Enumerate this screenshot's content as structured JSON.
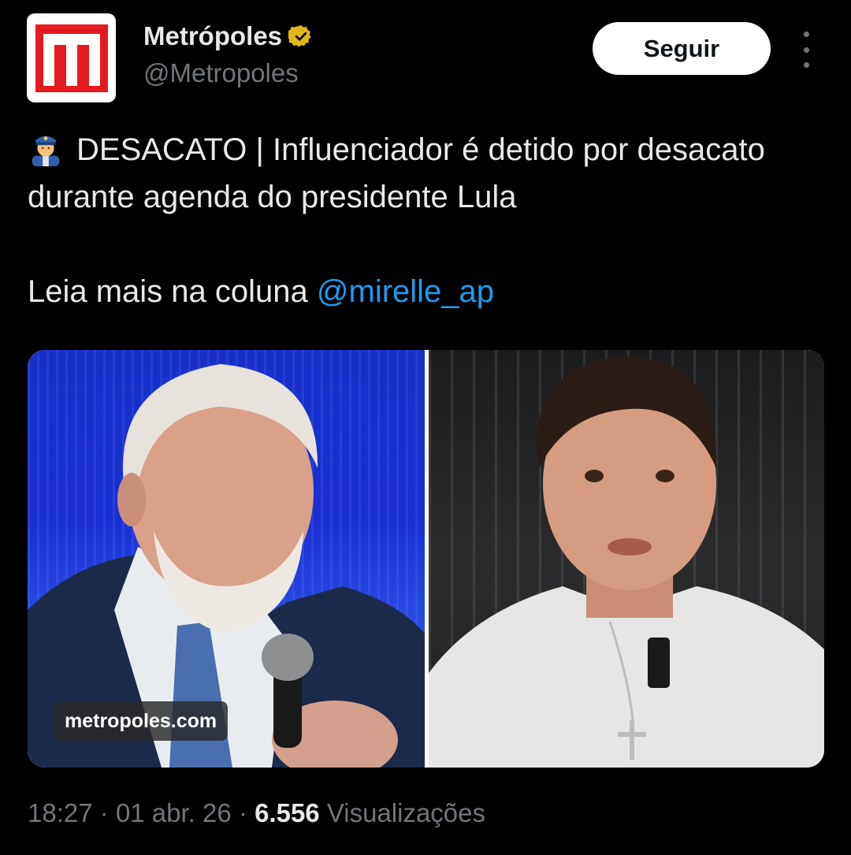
{
  "author": {
    "name": "Metrópoles",
    "handle": "@Metropoles",
    "verified": true,
    "avatar_icon": "metropoles-logo",
    "brand_color": "#e51a1f"
  },
  "follow_button": {
    "label": "Seguir"
  },
  "more_button": {
    "icon": "more-vertical-icon"
  },
  "tweet": {
    "emoji": "police-officer-icon",
    "line1": "DESACATO | Influenciador é detido por desacato durante agenda do presidente Lula",
    "line2_prefix": "Leia mais na coluna ",
    "mention": "@mirelle_ap",
    "mention_color": "#1d9bf0"
  },
  "media": {
    "watermark": "metropoles.com"
  },
  "meta": {
    "time": "18:27",
    "separator": "·",
    "date": "01 abr. 26",
    "views_count": "6.556",
    "views_label": "Visualizações"
  }
}
